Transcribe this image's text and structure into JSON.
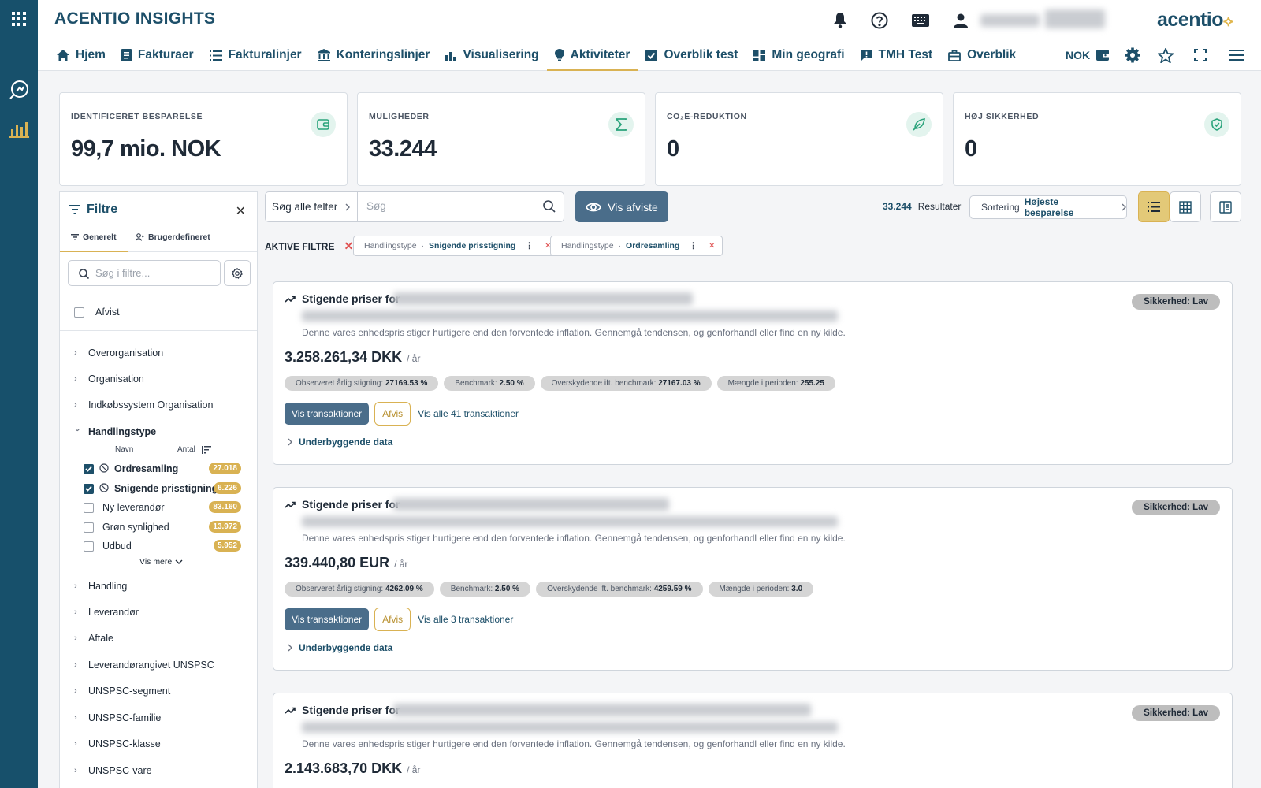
{
  "app": {
    "title": "ACENTIO INSIGHTS",
    "logo_text": "acentio",
    "currency": "NOK"
  },
  "nav": [
    {
      "label": "Hjem",
      "icon": "home-icon"
    },
    {
      "label": "Fakturaer",
      "icon": "invoice-icon"
    },
    {
      "label": "Fakturalinjer",
      "icon": "list-icon"
    },
    {
      "label": "Konteringslinjer",
      "icon": "bank-icon"
    },
    {
      "label": "Visualisering",
      "icon": "bar-chart-icon"
    },
    {
      "label": "Aktiviteter",
      "icon": "lightbulb-icon",
      "active": true
    },
    {
      "label": "Overblik test",
      "icon": "checkbox-icon"
    },
    {
      "label": "Min geografi",
      "icon": "dashboard-icon"
    },
    {
      "label": "TMH Test",
      "icon": "feedback-icon"
    },
    {
      "label": "Overblik",
      "icon": "briefcase-icon"
    }
  ],
  "kpis": [
    {
      "label": "IDENTIFICERET BESPARELSE",
      "value": "99,7 mio. NOK",
      "icon": "wallet-icon"
    },
    {
      "label": "MULIGHEDER",
      "value": "33.244",
      "icon": "sigma-icon"
    },
    {
      "label": "CO₂E-REDUKTION",
      "value": "0",
      "icon": "leaf-icon"
    },
    {
      "label": "HØJ SIKKERHED",
      "value": "0",
      "icon": "shield-icon"
    }
  ],
  "filters": {
    "title": "Filtre",
    "tabs": [
      "Generelt",
      "Brugerdefineret"
    ],
    "search_placeholder": "Søg i filtre...",
    "afvist_label": "Afvist",
    "groups_top": [
      "Overorganisation",
      "Organisation",
      "Indkøbssystem Organisation"
    ],
    "open_group": "Handlingstype",
    "col_name": "Navn",
    "col_count": "Antal",
    "options": [
      {
        "label": "Ordresamling",
        "count": "27.018",
        "checked": true
      },
      {
        "label": "Snigende prisstigning",
        "count": "6.226",
        "checked": true
      },
      {
        "label": "Ny leverandør",
        "count": "83.160",
        "checked": false
      },
      {
        "label": "Grøn synlighed",
        "count": "13.972",
        "checked": false
      },
      {
        "label": "Udbud",
        "count": "5.952",
        "checked": false
      }
    ],
    "show_more": "Vis mere",
    "groups_bottom": [
      "Handling",
      "Leverandør",
      "Aftale",
      "Leverandørangivet UNSPSC",
      "UNSPSC-segment",
      "UNSPSC-familie",
      "UNSPSC-klasse",
      "UNSPSC-vare"
    ]
  },
  "toolbar": {
    "search_scope": "Søg alle felter",
    "search_placeholder": "Søg",
    "show_rejected": "Vis afviste",
    "results_count": "33.244",
    "results_label": "Resultater",
    "sort_label": "Sortering",
    "sort_value": "Højeste besparelse"
  },
  "active_filters": {
    "label": "AKTIVE FILTRE",
    "chips": [
      {
        "key": "Handlingstype",
        "value": "Snigende prisstigning"
      },
      {
        "key": "Handlingstype",
        "value": "Ordresamling"
      }
    ]
  },
  "results": [
    {
      "title": "Stigende priser for",
      "description": "Denne vares enhedspris stiger hurtigere end den forventede inflation. Gennemgå tendensen, og genforhandl eller find en ny kilde.",
      "amount": "3.258.261,34 DKK",
      "per": "/ år",
      "badge": "Sikkerhed: Lav",
      "pills": [
        {
          "k": "Observeret årlig stigning:",
          "v": "27169.53 %"
        },
        {
          "k": "Benchmark:",
          "v": "2.50 %"
        },
        {
          "k": "Overskydende ift. benchmark:",
          "v": "27167.03 %"
        },
        {
          "k": "Mængde i perioden:",
          "v": "255.25"
        }
      ],
      "btn_tx": "Vis transaktioner",
      "btn_afvis": "Afvis",
      "link_all": "Vis alle 41 transaktioner",
      "underlying": "Underbyggende data"
    },
    {
      "title": "Stigende priser for",
      "description": "Denne vares enhedspris stiger hurtigere end den forventede inflation. Gennemgå tendensen, og genforhandl eller find en ny kilde.",
      "amount": "339.440,80 EUR",
      "per": "/ år",
      "badge": "Sikkerhed: Lav",
      "pills": [
        {
          "k": "Observeret årlig stigning:",
          "v": "4262.09 %"
        },
        {
          "k": "Benchmark:",
          "v": "2.50 %"
        },
        {
          "k": "Overskydende ift. benchmark:",
          "v": "4259.59 %"
        },
        {
          "k": "Mængde i perioden:",
          "v": "3.0"
        }
      ],
      "btn_tx": "Vis transaktioner",
      "btn_afvis": "Afvis",
      "link_all": "Vis alle 3 transaktioner",
      "underlying": "Underbyggende data"
    },
    {
      "title": "Stigende priser for",
      "description": "Denne vares enhedspris stiger hurtigere end den forventede inflation. Gennemgå tendensen, og genforhandl eller find en ny kilde.",
      "amount": "2.143.683,70 DKK",
      "per": "/ år",
      "badge": "Sikkerhed: Lav"
    }
  ]
}
